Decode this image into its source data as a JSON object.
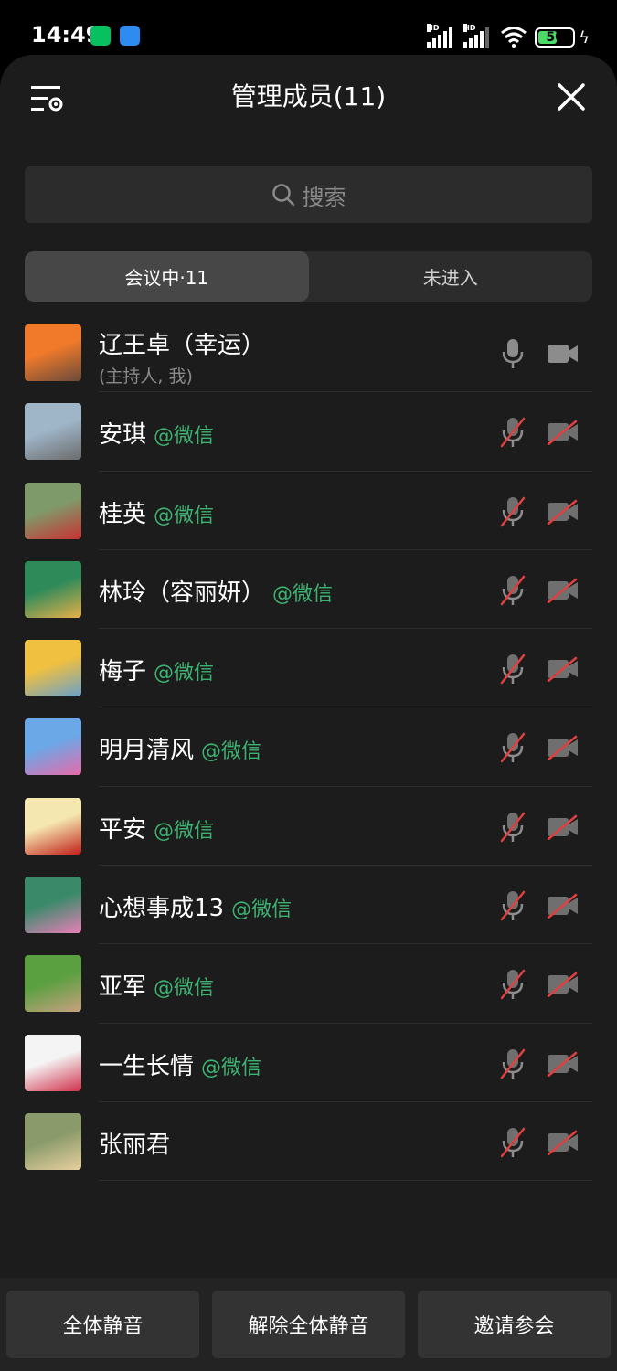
{
  "status_bar": {
    "time": "14:49",
    "apps": [
      "wechat-icon",
      "cloud-app-icon"
    ],
    "signal_label": "HD",
    "battery": "50"
  },
  "header": {
    "title": "管理成员(11)"
  },
  "search": {
    "placeholder": "搜索"
  },
  "tabs": [
    {
      "label": "会议中·11",
      "active": true
    },
    {
      "label": "未进入",
      "active": false
    }
  ],
  "members": [
    {
      "name": "辽王卓（幸运）",
      "tag": "",
      "sub": "(主持人, 我)",
      "mic_muted": false,
      "cam_off": false,
      "avatar_colors": [
        "#f07a2a",
        "#6a4a3a"
      ]
    },
    {
      "name": "安琪",
      "tag": "@微信",
      "sub": "",
      "mic_muted": true,
      "cam_off": true,
      "avatar_colors": [
        "#9fb6c9",
        "#6b6b6b"
      ]
    },
    {
      "name": "桂英",
      "tag": "@微信",
      "sub": "",
      "mic_muted": true,
      "cam_off": true,
      "avatar_colors": [
        "#7f9a6a",
        "#c83232"
      ]
    },
    {
      "name": "林玲（容丽妍）",
      "tag": "@微信",
      "sub": "",
      "mic_muted": true,
      "cam_off": true,
      "avatar_colors": [
        "#2f8a5a",
        "#e7b04a"
      ]
    },
    {
      "name": "梅子",
      "tag": "@微信",
      "sub": "",
      "mic_muted": true,
      "cam_off": true,
      "avatar_colors": [
        "#f0c040",
        "#6aa0c8"
      ]
    },
    {
      "name": "明月清风",
      "tag": "@微信",
      "sub": "",
      "mic_muted": true,
      "cam_off": true,
      "avatar_colors": [
        "#6aa8e8",
        "#e86aa8"
      ]
    },
    {
      "name": "平安",
      "tag": "@微信",
      "sub": "",
      "mic_muted": true,
      "cam_off": true,
      "avatar_colors": [
        "#f5e7b0",
        "#c0201a"
      ]
    },
    {
      "name": "心想事成13",
      "tag": "@微信",
      "sub": "",
      "mic_muted": true,
      "cam_off": true,
      "avatar_colors": [
        "#3a8a6a",
        "#e880b8"
      ]
    },
    {
      "name": "亚军",
      "tag": "@微信",
      "sub": "",
      "mic_muted": true,
      "cam_off": true,
      "avatar_colors": [
        "#5aa040",
        "#c8a080"
      ]
    },
    {
      "name": "一生长情",
      "tag": "@微信",
      "sub": "",
      "mic_muted": true,
      "cam_off": true,
      "avatar_colors": [
        "#f4f4f4",
        "#d0304a"
      ]
    },
    {
      "name": "张丽君",
      "tag": "",
      "sub": "",
      "mic_muted": true,
      "cam_off": true,
      "avatar_colors": [
        "#8a9a6a",
        "#e8d0a0"
      ]
    }
  ],
  "footer": {
    "mute_all": "全体静音",
    "unmute_all": "解除全体静音",
    "invite": "邀请参会"
  },
  "colors": {
    "accent_green": "#3cb371",
    "muted_red": "#e04040"
  }
}
